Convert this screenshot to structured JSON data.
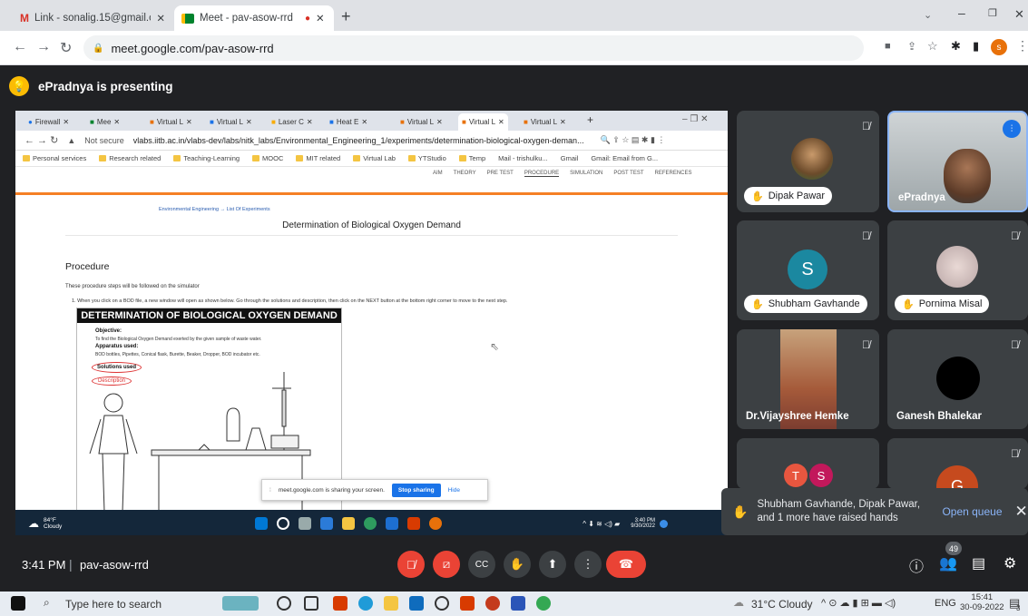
{
  "browser": {
    "tabs": [
      {
        "title": "Link - sonalig.15@gmail.com - G",
        "icon": "gmail-icon"
      },
      {
        "title": "Meet - pav-asow-rrd",
        "icon": "meet-icon"
      }
    ],
    "url": "meet.google.com/pav-asow-rrd"
  },
  "meet": {
    "presenting": "ePradnya is presenting",
    "time": "3:41 PM",
    "sep": "|",
    "code": "pav-asow-rrd",
    "participants_count": "49",
    "hands_text": "Shubham Gavhande, Dipak Pawar, and 1 more have raised hands",
    "open_queue": "Open queue"
  },
  "participants": [
    {
      "name": "Dipak Pawar"
    },
    {
      "name": "ePradnya"
    },
    {
      "name": "Shubham Gavhande",
      "initial": "S",
      "color": "#1b88a0"
    },
    {
      "name": "Pornima Misal"
    },
    {
      "name": "Dr.Vijayshree Hemke"
    },
    {
      "name": "Ganesh Bhalekar"
    },
    {
      "initials": [
        "T",
        "S"
      ],
      "colors": [
        "#e8563f",
        "#c2185b"
      ]
    },
    {
      "initial": "G",
      "color": "#c64a1e"
    }
  ],
  "shared": {
    "tabs": [
      "Firewall",
      "Mee",
      "Virtual L",
      "Virtual L",
      "Laser C",
      "Heat E",
      "Virtual L",
      "Virtual L",
      "Virtual L"
    ],
    "not_secure": "Not secure",
    "url": "vlabs.iitb.ac.in/vlabs-dev/labs/nitk_labs/Environmental_Engineering_1/experiments/determination-biological-oxygen-deman...",
    "bookmarks": [
      "Personal services",
      "Research related",
      "Teaching-Learning",
      "MOOC",
      "MIT related",
      "Virtual Lab",
      "YTStudio",
      "Temp",
      "Mail - trishulku...",
      "Gmail",
      "Gmail: Email from G..."
    ],
    "page_nav": [
      "AIM",
      "THEORY",
      "PRE TEST",
      "PROCEDURE",
      "SIMULATION",
      "POST TEST",
      "REFERENCES"
    ],
    "breadcrumb": "Environmental Engineering → List Of Experiments",
    "title": "Determination of Biological Oxygen Demand",
    "procedure_heading": "Procedure",
    "steps_intro": "These procedure steps will be followed on the simulator",
    "step1": "1. When you click on a BOD file, a new window will open as shown below. Go through the solutions and description, then click on the NEXT button at the bottom right corner to move to the next step.",
    "sim_title": "DETERMINATION OF BIOLOGICAL OXYGEN DEMAND",
    "objective_label": "Objective:",
    "objective_text": "To find the Biological Oxygen Demand exerted by the given sample of waste water.",
    "apparatus_label": "Apparatus used:",
    "apparatus_text": "BOD bottles, Pipettes, Conical flask, Burette, Beaker, Dropper, BOD incubator etc.",
    "solutions_btn": "Solutions used",
    "description_btn": "Description",
    "share_notice": "meet.google.com is sharing your screen.",
    "stop_sharing": "Stop sharing",
    "hide": "Hide",
    "weather_temp": "84°F",
    "weather_text": "Cloudy",
    "clock_time": "3:40 PM",
    "clock_date": "9/30/2022"
  },
  "taskbar": {
    "search_placeholder": "Type here to search",
    "weather": "31°C Cloudy",
    "lang": "ENG",
    "time": "15:41",
    "date": "30-09-2022",
    "notif": "3"
  }
}
